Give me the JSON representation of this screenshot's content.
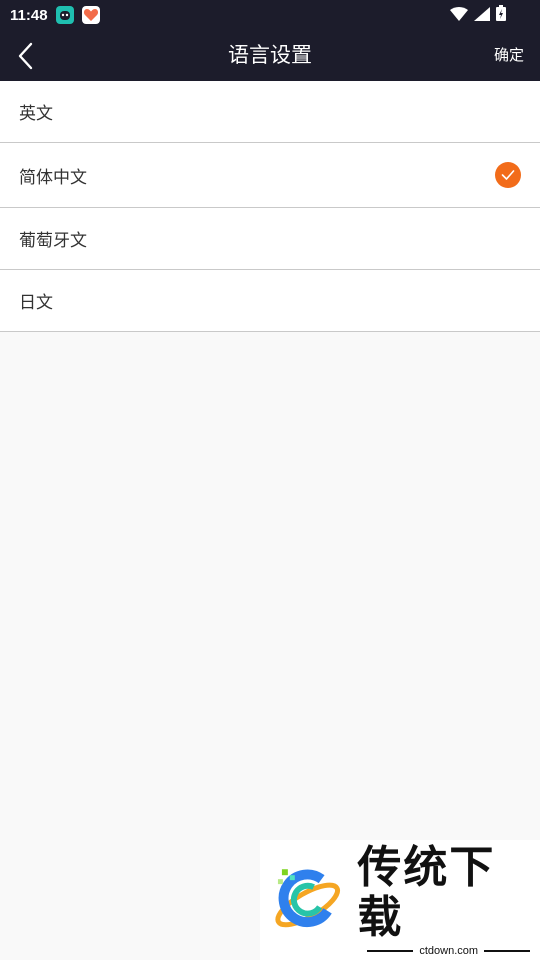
{
  "status_bar": {
    "time": "11:48",
    "icons": [
      "app-icon-teal",
      "app-icon-heart",
      "wifi-icon",
      "signal-icon",
      "battery-icon"
    ]
  },
  "header": {
    "title": "语言设置",
    "confirm_label": "确定",
    "back_icon": "chevron-left-icon"
  },
  "languages": {
    "items": [
      {
        "label": "英文",
        "selected": false
      },
      {
        "label": "简体中文",
        "selected": true
      },
      {
        "label": "葡萄牙文",
        "selected": false
      },
      {
        "label": "日文",
        "selected": false
      }
    ]
  },
  "watermark": {
    "title": "传统下载",
    "subtitle": "ctdown.com"
  },
  "colors": {
    "header_bg": "#1c1c2b",
    "accent": "#f26c1a",
    "background": "#f9f9f9",
    "divider": "#c9c9c9"
  }
}
